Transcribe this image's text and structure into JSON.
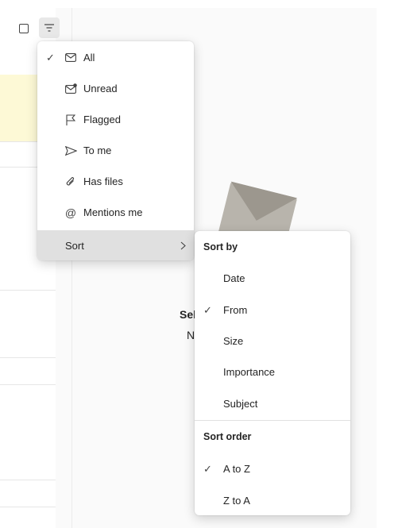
{
  "toolbar": {
    "select_icon": "checkbox-square-icon",
    "filter_icon": "filter-icon"
  },
  "background": {
    "reading_pane_partial_title": "Sel",
    "reading_pane_partial_sub": "N",
    "envelope_icon": "envelope-illustration"
  },
  "filter_menu": {
    "items": [
      {
        "label": "All",
        "icon": "envelope-icon",
        "checked": true
      },
      {
        "label": "Unread",
        "icon": "unread-envelope-icon",
        "checked": false
      },
      {
        "label": "Flagged",
        "icon": "flag-icon",
        "checked": false
      },
      {
        "label": "To me",
        "icon": "send-arrow-icon",
        "checked": false
      },
      {
        "label": "Has files",
        "icon": "paperclip-icon",
        "checked": false
      },
      {
        "label": "Mentions me",
        "icon": "at-sign-icon",
        "checked": false
      }
    ],
    "sort": {
      "label": "Sort",
      "icon": "chevron-right-icon"
    },
    "check_glyph": "✓"
  },
  "sort_menu": {
    "sort_by_header": "Sort by",
    "sort_by": [
      {
        "label": "Date",
        "checked": false
      },
      {
        "label": "From",
        "checked": true
      },
      {
        "label": "Size",
        "checked": false
      },
      {
        "label": "Importance",
        "checked": false
      },
      {
        "label": "Subject",
        "checked": false
      }
    ],
    "sort_order_header": "Sort order",
    "sort_order": [
      {
        "label": "A to Z",
        "checked": true
      },
      {
        "label": "Z to A",
        "checked": false
      }
    ],
    "check_glyph": "✓"
  },
  "colors": {
    "highlight": "#e0e0e0",
    "flagged_row": "#fdf9d6",
    "text": "#242424"
  }
}
